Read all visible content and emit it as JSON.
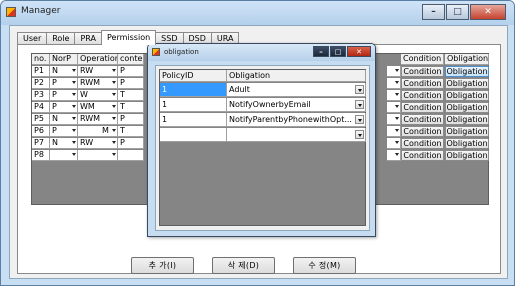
{
  "window": {
    "title": "Manager",
    "caption_minimize": "–",
    "caption_maximize": "□",
    "caption_close": "✕"
  },
  "tabs": [
    {
      "label": "User"
    },
    {
      "label": "Role"
    },
    {
      "label": "PRA"
    },
    {
      "label": "Permission"
    },
    {
      "label": "SSD"
    },
    {
      "label": "DSD"
    },
    {
      "label": "URA"
    }
  ],
  "active_tab": "Permission",
  "grid": {
    "headers": {
      "no": "no.",
      "norp": "NorP",
      "operation": "Operation",
      "conte": "conte",
      "condition": "Condition",
      "obligation": "Obligation"
    },
    "rows": [
      {
        "no": "P1",
        "norp": "N",
        "operation": "RW",
        "conte": "P",
        "condition": "Condition",
        "obligation": "Obligation"
      },
      {
        "no": "P2",
        "norp": "P",
        "operation": "RWM",
        "conte": "P",
        "condition": "Condition",
        "obligation": "Obligation"
      },
      {
        "no": "P3",
        "norp": "P",
        "operation": "W",
        "conte": "T",
        "condition": "Condition",
        "obligation": "Obligation"
      },
      {
        "no": "P4",
        "norp": "P",
        "operation": "WM",
        "conte": "T",
        "condition": "Condition",
        "obligation": "Obligation"
      },
      {
        "no": "P5",
        "norp": "N",
        "operation": "RWM",
        "conte": "P",
        "condition": "Condition",
        "obligation": "Obligation"
      },
      {
        "no": "P6",
        "norp": "P",
        "operation": "M",
        "conte": "T",
        "condition": "Condition",
        "obligation": "Obligation"
      },
      {
        "no": "P7",
        "norp": "N",
        "operation": "RW",
        "conte": "P",
        "condition": "Condition",
        "obligation": "Obligation"
      },
      {
        "no": "P8",
        "norp": "",
        "operation": "",
        "conte": "",
        "condition": "Condition",
        "obligation": "Obligation"
      }
    ]
  },
  "buttons": {
    "add": "추 가(I)",
    "delete": "삭 제(D)",
    "edit": "수 정(M)"
  },
  "dialog": {
    "title": "obligation",
    "headers": {
      "policy": "PolicyID",
      "obligation": "Obligation"
    },
    "rows": [
      {
        "policy": "1",
        "obligation": "Adult"
      },
      {
        "policy": "1",
        "obligation": "NotifyOwnerbyEmail"
      },
      {
        "policy": "1",
        "obligation": "NotifyParentbyPhonewithOpt..."
      },
      {
        "policy": "",
        "obligation": ""
      }
    ]
  }
}
